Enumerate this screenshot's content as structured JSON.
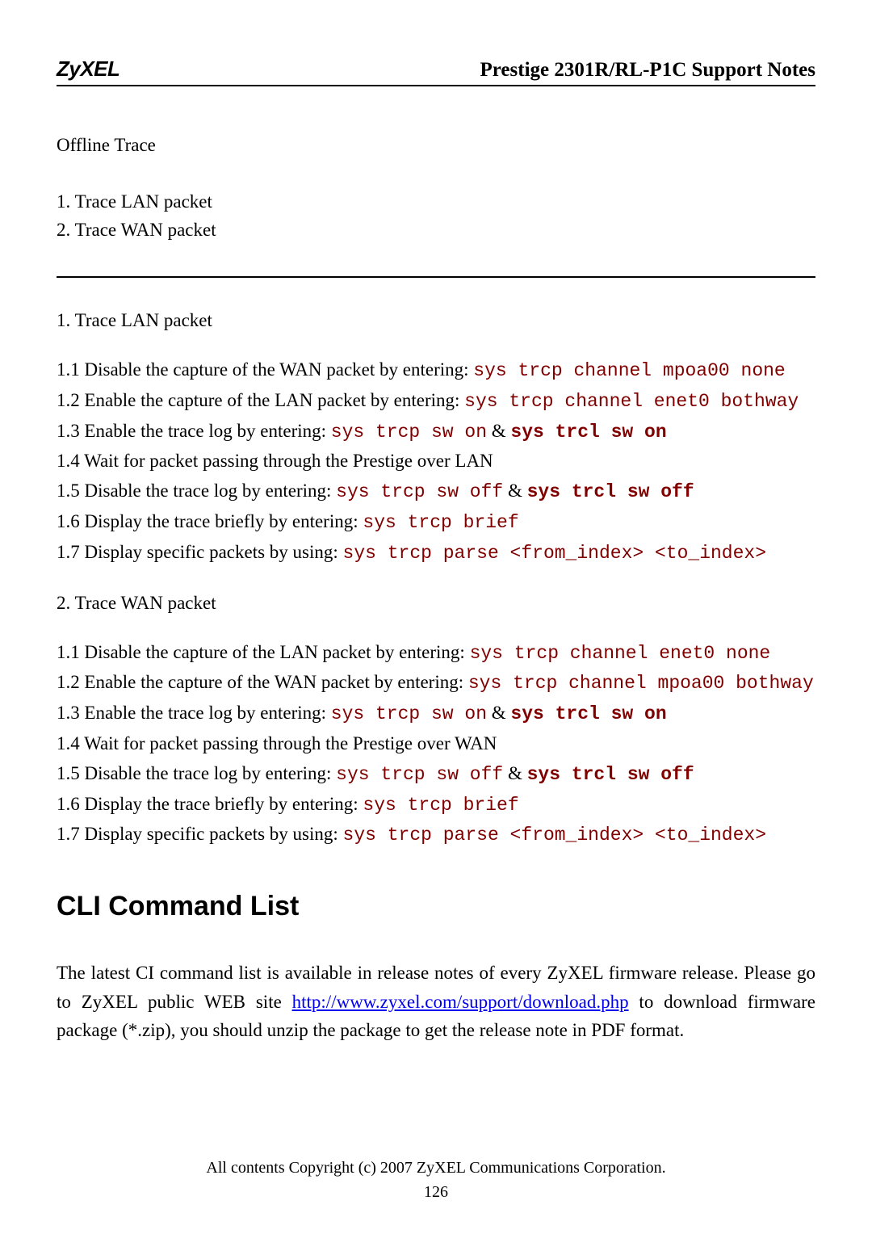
{
  "header": {
    "logo": "ZyXEL",
    "title": "Prestige 2301R/RL-P1C Support Notes"
  },
  "subheading": "Offline Trace",
  "toc": {
    "item1": "1. Trace LAN packet",
    "item2": "2. Trace WAN packet"
  },
  "lan": {
    "title": "1. Trace LAN packet",
    "s1_pre": "1.1 Disable the capture of the WAN packet by entering: ",
    "s1_cmd": "sys trcp channel mpoa00 none",
    "s2_pre": "1.2 Enable the capture of the LAN packet by entering: ",
    "s2_cmd": "sys trcp channel enet0 bothway",
    "s3_pre": "1.3 Enable the trace log by entering: ",
    "s3_cmd1": "sys trcp sw on",
    "s3_amp": " & ",
    "s3_cmd2": "sys trcl sw on",
    "s4": "1.4 Wait for packet passing through the Prestige over LAN",
    "s5_pre": "1.5 Disable the trace log by entering: ",
    "s5_cmd1": "sys trcp sw off",
    "s5_amp": " & ",
    "s5_cmd2": "sys trcl sw off",
    "s6_pre": "1.6 Display the trace briefly by entering: ",
    "s6_cmd": "sys trcp brief",
    "s7_pre": "1.7 Display specific packets by using: ",
    "s7_cmd": "sys trcp parse <from_index> <to_index>"
  },
  "wan": {
    "title": "2. Trace WAN packet",
    "s1_pre": "1.1 Disable the capture of the LAN packet by entering: ",
    "s1_cmd": "sys trcp channel enet0 none",
    "s2_pre": "1.2 Enable the capture of the WAN packet by entering: ",
    "s2_cmd": "sys trcp channel mpoa00 bothway",
    "s3_pre": "1.3 Enable the trace log by entering: ",
    "s3_cmd1": "sys trcp sw on",
    "s3_amp": " & ",
    "s3_cmd2": "sys trcl sw on",
    "s4": "1.4 Wait for packet passing through the Prestige over WAN",
    "s5_pre": "1.5 Disable the trace log by entering: ",
    "s5_cmd1": "sys trcp sw off",
    "s5_amp": " & ",
    "s5_cmd2": "sys trcl sw off",
    "s6_pre": "1.6 Display the trace briefly by entering: ",
    "s6_cmd": "sys trcp brief",
    "s7_pre": "1.7 Display specific packets by using: ",
    "s7_cmd": "sys trcp parse <from_index> <to_index>"
  },
  "cli": {
    "heading": "CLI Command List",
    "para_pre": "The latest CI command list is available in release notes of every ZyXEL firmware release. Please go to ZyXEL public WEB site   ",
    "link": "http://www.zyxel.com/support/download.php",
    "para_post": " to download firmware package (*.zip), you should unzip the package to get the release note in PDF format."
  },
  "footer": {
    "copyright": "All contents Copyright (c) 2007 ZyXEL Communications Corporation.",
    "page": "126"
  }
}
